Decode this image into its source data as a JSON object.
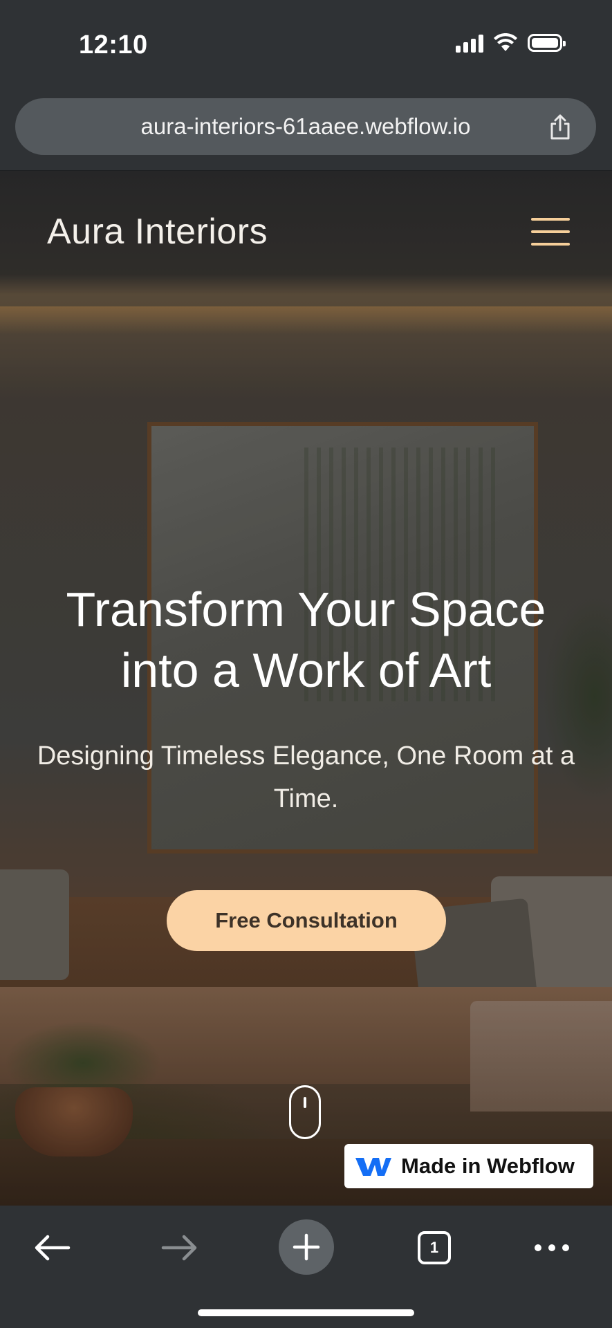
{
  "status_bar": {
    "time": "12:10"
  },
  "browser": {
    "url": "aura-interiors-61aaee.webflow.io",
    "open_tabs_count": "1"
  },
  "site": {
    "brand": "Aura Interiors",
    "headline_line1": "Transform Your Space",
    "headline_line2": "into a Work of Art",
    "subheadline": "Designing Timeless Elegance, One Room at a Time.",
    "cta_label": "Free Consultation",
    "badge_label": "Made in Webflow",
    "colors": {
      "accent": "#fbd3a5",
      "menu_icon": "#f6cf9a",
      "webflow_blue": "#146ef5"
    }
  },
  "icons": {
    "share": "share-icon",
    "menu": "hamburger-menu-icon",
    "scroll": "scroll-mouse-icon",
    "back": "arrow-left-icon",
    "forward": "arrow-right-icon",
    "new_tab": "plus-icon",
    "tabs": "tabs-icon",
    "more": "more-dots-icon"
  }
}
